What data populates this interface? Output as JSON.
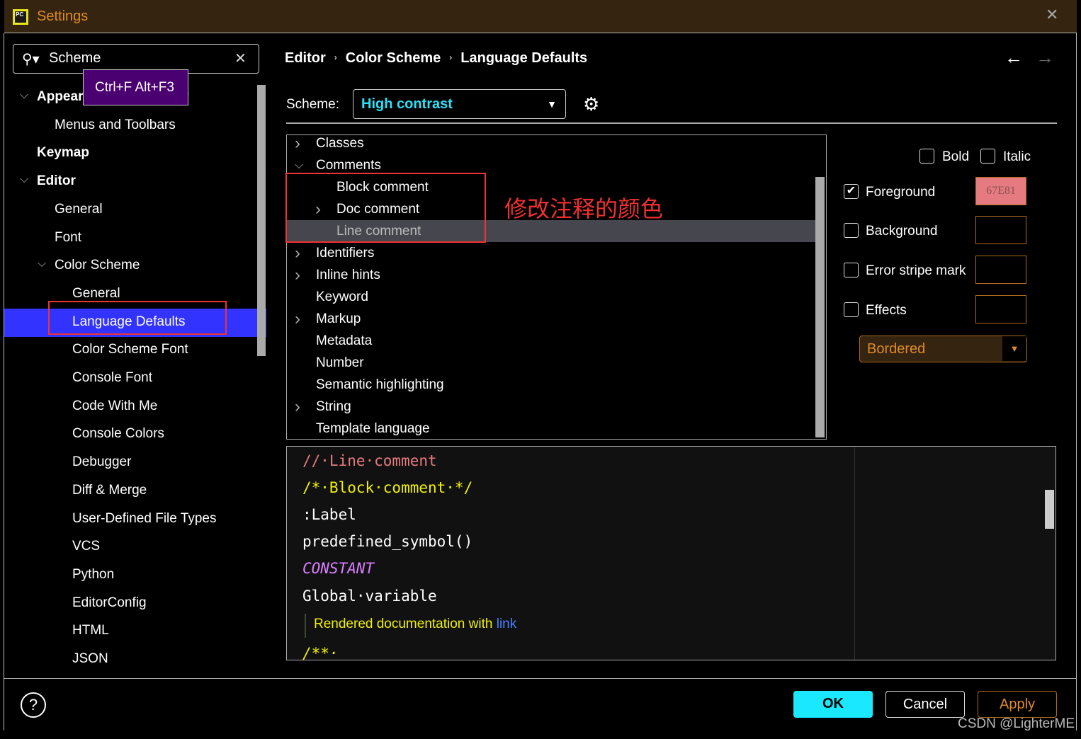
{
  "window": {
    "title": "Settings",
    "app_icon": "pycharm-icon"
  },
  "search": {
    "value": "Scheme",
    "tooltip": "Ctrl+F Alt+F3"
  },
  "sidebar": {
    "items": [
      {
        "label": "Appearance & Behavior",
        "bold": true,
        "expanded": true
      },
      {
        "label": "Menus and Toolbars"
      },
      {
        "label": "Keymap",
        "bold": true
      },
      {
        "label": "Editor",
        "bold": true,
        "expanded": true
      },
      {
        "label": "General"
      },
      {
        "label": "Font"
      },
      {
        "label": "Color Scheme",
        "expanded": true
      },
      {
        "label": "General"
      },
      {
        "label": "Language Defaults",
        "selected": true
      },
      {
        "label": "Color Scheme Font"
      },
      {
        "label": "Console Font"
      },
      {
        "label": "Code With Me"
      },
      {
        "label": "Console Colors"
      },
      {
        "label": "Debugger"
      },
      {
        "label": "Diff & Merge"
      },
      {
        "label": "User-Defined File Types"
      },
      {
        "label": "VCS"
      },
      {
        "label": "Python"
      },
      {
        "label": "EditorConfig"
      },
      {
        "label": "HTML"
      },
      {
        "label": "JSON"
      }
    ]
  },
  "breadcrumb": [
    "Editor",
    "Color Scheme",
    "Language Defaults"
  ],
  "scheme": {
    "label": "Scheme:",
    "value": "High contrast"
  },
  "tree": [
    {
      "label": "Classes",
      "chevron": "right"
    },
    {
      "label": "Comments",
      "chevron": "down"
    },
    {
      "label": "Block comment",
      "child": true
    },
    {
      "label": "Doc comment",
      "child": true,
      "chevron": "right"
    },
    {
      "label": "Line comment",
      "child": true,
      "selected": true
    },
    {
      "label": "Identifiers",
      "chevron": "right"
    },
    {
      "label": "Inline hints",
      "chevron": "right"
    },
    {
      "label": "Keyword"
    },
    {
      "label": "Markup",
      "chevron": "right"
    },
    {
      "label": "Metadata"
    },
    {
      "label": "Number"
    },
    {
      "label": "Semantic highlighting"
    },
    {
      "label": "String",
      "chevron": "right"
    },
    {
      "label": "Template language"
    }
  ],
  "annotation": "修改注释的颜色",
  "attributes": {
    "bold": {
      "label": "Bold",
      "checked": false
    },
    "italic": {
      "label": "Italic",
      "checked": false
    },
    "foreground": {
      "label": "Foreground",
      "checked": true,
      "value": "67E81",
      "color": "#e57b81"
    },
    "background": {
      "label": "Background",
      "checked": false
    },
    "error_stripe": {
      "label": "Error stripe mark",
      "checked": false
    },
    "effects": {
      "label": "Effects",
      "checked": false,
      "type": "Bordered"
    }
  },
  "preview": {
    "line_comment": "//·Line·comment",
    "block_comment": "/*·Block·comment·*/",
    "label": ":Label",
    "predefined": "predefined_symbol()",
    "constant": "CONSTANT",
    "global": "Global·variable",
    "doc_text": "Rendered documentation with ",
    "doc_link": "link",
    "doc_start": "/**·"
  },
  "buttons": {
    "ok": "OK",
    "cancel": "Cancel",
    "apply": "Apply",
    "help": "?"
  },
  "watermark": "CSDN @LighterME"
}
